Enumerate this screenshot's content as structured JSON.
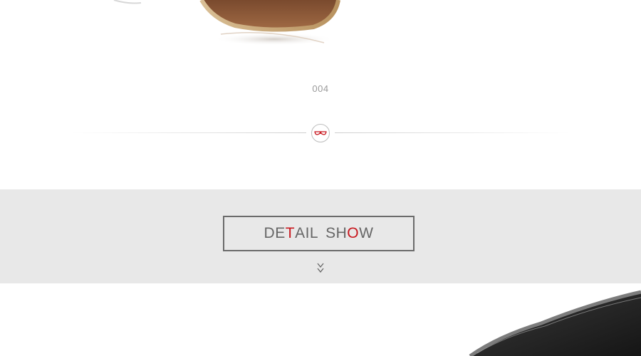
{
  "product": {
    "code": "004",
    "lens_color": "#8a5a3a",
    "frame_color": "#caa97a"
  },
  "section": {
    "title_parts": [
      "DE",
      "T",
      "AIL",
      "SH",
      "O",
      "W"
    ],
    "accent_color": "#c8161d",
    "text_color": "#666666",
    "band_color": "#e8e8e8"
  },
  "icons": {
    "divider_badge": "glasses-icon",
    "scroll_hint": "double-chevron-down-icon"
  }
}
